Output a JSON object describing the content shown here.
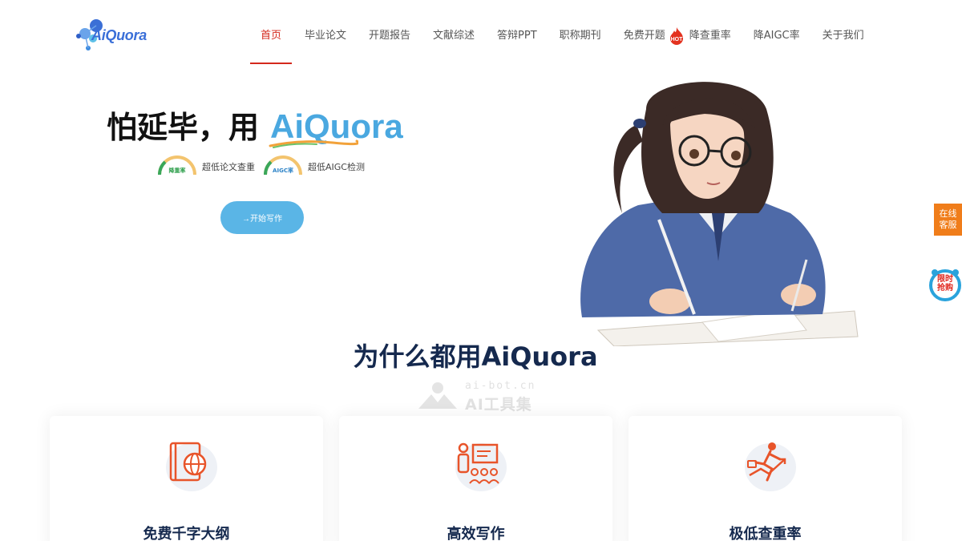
{
  "header": {
    "logo_text": "AiQuora",
    "nav": [
      {
        "label": "首页",
        "active": true
      },
      {
        "label": "毕业论文"
      },
      {
        "label": "开题报告"
      },
      {
        "label": "文献综述"
      },
      {
        "label": "答辩PPT"
      },
      {
        "label": "职称期刊"
      },
      {
        "label": "免费开题",
        "badge": "HOT"
      },
      {
        "label": "降查重率"
      },
      {
        "label": "降AIGC率"
      },
      {
        "label": "关于我们"
      }
    ]
  },
  "hero": {
    "title_prefix": "怕延毕，用",
    "title_brand": "AiQuora",
    "features": [
      {
        "gauge_label": "降重率",
        "text": "超低论文查重"
      },
      {
        "gauge_label": "AIGC率",
        "text": "超低AIGC检测"
      }
    ],
    "cta_label": "→开始写作"
  },
  "side": {
    "service_label": "在线客服",
    "service_line1": "在线",
    "service_line2": "客服",
    "sale_line1": "限时",
    "sale_line2": "抢购"
  },
  "watermark": {
    "domain": "ai-bot.cn",
    "name": "AI工具集"
  },
  "why": {
    "title": "为什么都用AiQuora",
    "cards": [
      {
        "title": "免费千字大纲",
        "icon": "book-globe-icon"
      },
      {
        "title": "高效写作",
        "icon": "presentation-team-icon"
      },
      {
        "title": "极低查重率",
        "icon": "runner-growth-icon"
      }
    ]
  },
  "colors": {
    "accent_red": "#d4281c",
    "brand_blue": "#4aa8e0",
    "cta_blue": "#5ab5e6",
    "navy": "#15294e",
    "orange": "#f07d1a"
  }
}
